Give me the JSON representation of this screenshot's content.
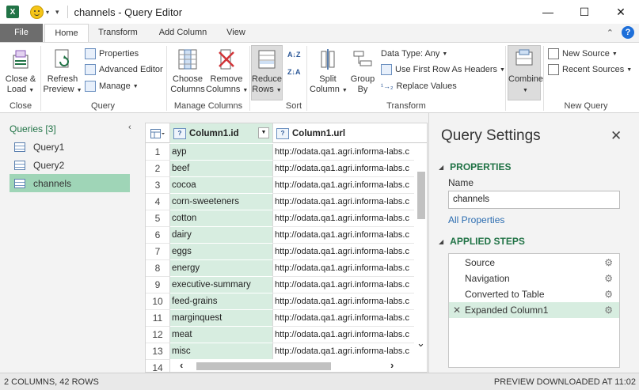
{
  "window": {
    "title": "channels - Query Editor",
    "app_icon": "excel-icon",
    "minimize": "—",
    "maximize": "☐",
    "close": "✕"
  },
  "tabs": {
    "file": "File",
    "home": "Home",
    "transform": "Transform",
    "add_column": "Add Column",
    "view": "View"
  },
  "ribbon": {
    "close_load": [
      "Close &",
      "Load"
    ],
    "refresh_preview": [
      "Refresh",
      "Preview"
    ],
    "properties": "Properties",
    "advanced_editor": "Advanced Editor",
    "manage": "Manage",
    "choose_columns": [
      "Choose",
      "Columns"
    ],
    "remove_columns": [
      "Remove",
      "Columns"
    ],
    "reduce_rows": [
      "Reduce",
      "Rows"
    ],
    "split_column": [
      "Split",
      "Column"
    ],
    "group_by": [
      "Group",
      "By"
    ],
    "data_type": "Data Type: Any",
    "use_first_row": "Use First Row As Headers",
    "replace_values": "Replace Values",
    "combine": "Combine",
    "new_source": "New Source",
    "recent_sources": "Recent Sources",
    "groups": {
      "close": "Close",
      "query": "Query",
      "manage_columns": "Manage Columns",
      "sort": "Sort",
      "transform": "Transform",
      "new_query": "New Query"
    }
  },
  "queries": {
    "header": "Queries [3]",
    "collapse": "‹",
    "items": [
      "Query1",
      "Query2",
      "channels"
    ]
  },
  "grid": {
    "columns": [
      "Column1.id",
      "Column1.url"
    ],
    "rows": [
      {
        "n": "1",
        "id": "ayp",
        "url": "http://odata.qa1.agri.informa-labs.c"
      },
      {
        "n": "2",
        "id": "beef",
        "url": "http://odata.qa1.agri.informa-labs.c"
      },
      {
        "n": "3",
        "id": "cocoa",
        "url": "http://odata.qa1.agri.informa-labs.c"
      },
      {
        "n": "4",
        "id": "corn-sweeteners",
        "url": "http://odata.qa1.agri.informa-labs.c"
      },
      {
        "n": "5",
        "id": "cotton",
        "url": "http://odata.qa1.agri.informa-labs.c"
      },
      {
        "n": "6",
        "id": "dairy",
        "url": "http://odata.qa1.agri.informa-labs.c"
      },
      {
        "n": "7",
        "id": "eggs",
        "url": "http://odata.qa1.agri.informa-labs.c"
      },
      {
        "n": "8",
        "id": "energy",
        "url": "http://odata.qa1.agri.informa-labs.c"
      },
      {
        "n": "9",
        "id": "executive-summary",
        "url": "http://odata.qa1.agri.informa-labs.c"
      },
      {
        "n": "10",
        "id": "feed-grains",
        "url": "http://odata.qa1.agri.informa-labs.c"
      },
      {
        "n": "11",
        "id": "marginquest",
        "url": "http://odata.qa1.agri.informa-labs.c"
      },
      {
        "n": "12",
        "id": "meat",
        "url": "http://odata.qa1.agri.informa-labs.c"
      },
      {
        "n": "13",
        "id": "misc",
        "url": "http://odata.qa1.agri.informa-labs.c"
      },
      {
        "n": "14",
        "id": "",
        "url": ""
      }
    ]
  },
  "settings": {
    "title": "Query Settings",
    "properties_header": "PROPERTIES",
    "name_label": "Name",
    "name_value": "channels",
    "all_properties": "All Properties",
    "applied_steps_header": "APPLIED STEPS",
    "steps": [
      "Source",
      "Navigation",
      "Converted to Table",
      "Expanded Column1"
    ],
    "selected_step": 3
  },
  "status": {
    "left": "2 COLUMNS, 42 ROWS",
    "right": "PREVIEW DOWNLOADED AT 11:02"
  },
  "colors": {
    "accent_green": "#217346",
    "selected_query": "#9fd5b7",
    "selected_column": "#d7ede0",
    "file_tab": "#6d6d6d"
  }
}
